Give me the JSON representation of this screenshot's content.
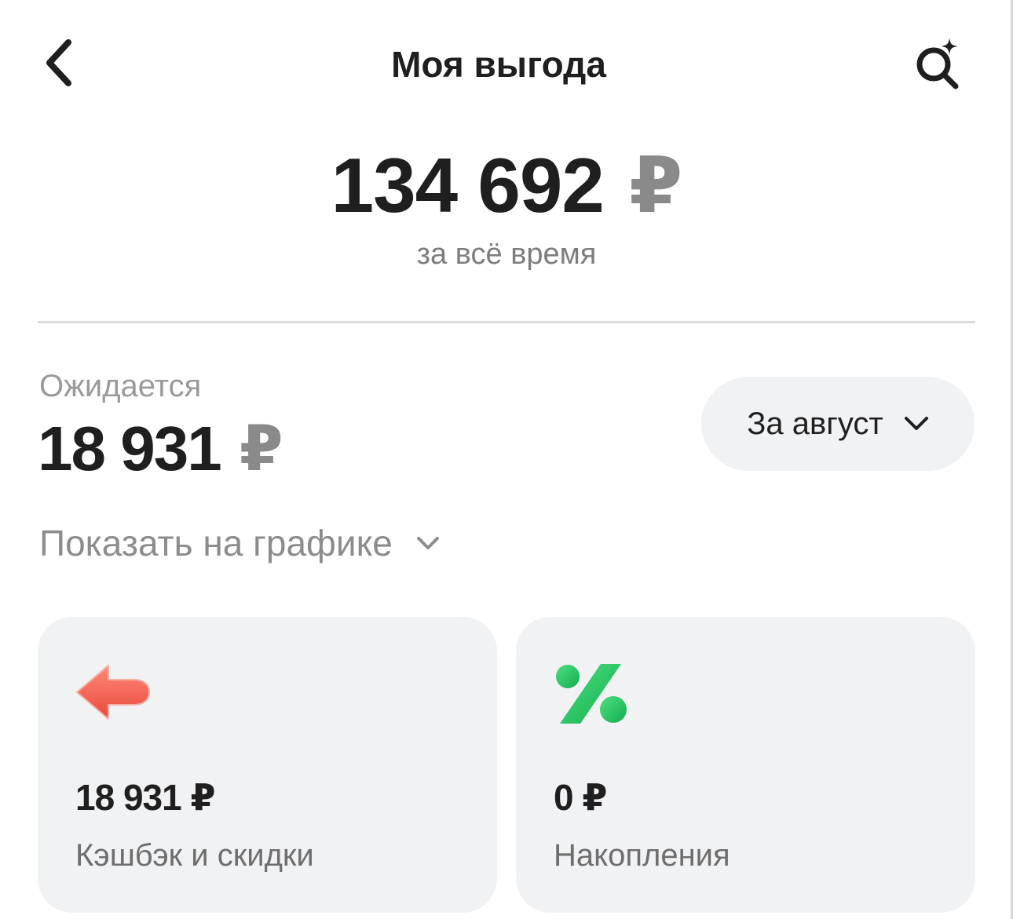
{
  "header": {
    "title": "Моя выгода",
    "back_icon": "chevron-left-icon",
    "search_icon": "search-sparkle-icon"
  },
  "summary": {
    "total_amount": "134 692",
    "currency": "₽",
    "caption": "за всё время"
  },
  "expected": {
    "label": "Ожидается",
    "amount": "18 931",
    "currency": "₽"
  },
  "period_select": {
    "selected": "За август",
    "icon": "chevron-down-icon"
  },
  "chart_toggle": {
    "label": "Показать на графике",
    "icon": "chevron-down-icon"
  },
  "cards": [
    {
      "amount": "18 931 ₽",
      "label": "Кэшбэк и скидки",
      "icon": "arrow-back-icon",
      "icon_color": "#f26a5a"
    },
    {
      "amount": "0 ₽",
      "label": "Накопления",
      "icon": "percent-icon",
      "icon_color": "#21c160"
    }
  ],
  "colors": {
    "background": "#ffffff",
    "card_background": "#f1f2f4",
    "text_primary": "#1f1f1f",
    "text_secondary": "#8c8c8c"
  }
}
